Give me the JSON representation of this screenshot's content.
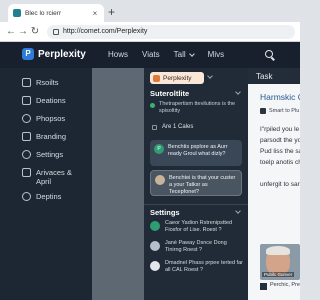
{
  "browser": {
    "tab_title": "Blec lo rcierr",
    "tab_close": "×",
    "new_tab": "+",
    "url": "http://comet.com/Perplexity",
    "back": "←",
    "forward": "→",
    "reload": "↻"
  },
  "header": {
    "brand": "Perplexity",
    "brand_letter": "P",
    "nav": [
      {
        "label": "Hows"
      },
      {
        "label": "Viats"
      },
      {
        "label": "Tall"
      },
      {
        "label": "Mivs"
      }
    ]
  },
  "sidebar": {
    "items": [
      {
        "label": "Rsoilts"
      },
      {
        "label": "Deations"
      },
      {
        "label": "Phopsos"
      },
      {
        "label": "Branding"
      },
      {
        "label": "Settings"
      },
      {
        "label": "Arivaces & April"
      },
      {
        "label": "Deptins"
      }
    ]
  },
  "assistant": {
    "pill_label": "Perplexity",
    "title": "Suteroltlite",
    "suggestion": "Thetrapertism ttevilutions is the spisoltity",
    "cases": "Are 1 Cales",
    "cards": [
      {
        "text": "Benchtis pxplore as Aurr ready Groul what dizly?",
        "avatar": "P"
      },
      {
        "text": "Benchtei is that your custer a your Tatksr as Tecepfonet?",
        "avatar": ""
      }
    ],
    "settings_title": "Settings",
    "settings_items": [
      {
        "text": "Caeor Yadion Rstrenipstted Fiosfor of Lise. Roest ?"
      },
      {
        "text": "Janè Paway Dsnce Dong Tinirng Roest ?"
      },
      {
        "text": "Dmadnel Phass prpee terted far all CAL Roest ?"
      }
    ]
  },
  "task_panel": {
    "header": "Task",
    "title": "Harmskic Co",
    "chip": "Smart to Plu",
    "paragraph": [
      "I\"rpiled you le",
      "parsodt the yo",
      "Pud liss the sa",
      "toelp anotis ch",
      "",
      "unfergit to sar"
    ],
    "photo_caption": "Pubilc Gunver",
    "footer": "Perchic, Pre Perplexity"
  },
  "colors": {
    "accent": "#2f7bd8",
    "header_bg": "#17202c",
    "sidebar_bg": "#1d2734",
    "panel_bg": "#212b37",
    "pill_bg": "#fbe7d7",
    "task_title": "#2a5a8c"
  },
  "icons": [
    "search-icon",
    "lock-icon",
    "chevron-down-icon",
    "close-icon"
  ]
}
